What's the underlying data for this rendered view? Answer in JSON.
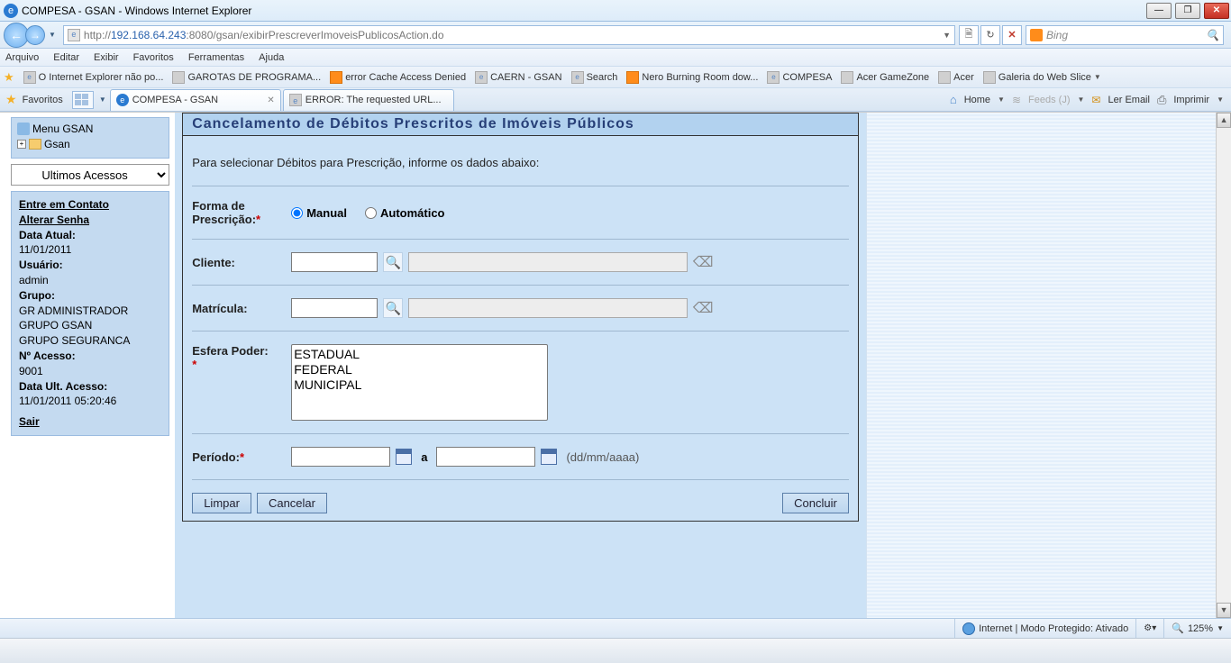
{
  "window": {
    "title": "COMPESA - GSAN - Windows Internet Explorer"
  },
  "url": {
    "prefix": "http://",
    "host": "192.168.64.243",
    "port": ":8080",
    "path": "/gsan/exibirPrescreverImoveisPublicosAction.do"
  },
  "search_provider": "Bing",
  "menu": [
    "Arquivo",
    "Editar",
    "Exibir",
    "Favoritos",
    "Ferramentas",
    "Ajuda"
  ],
  "bookmarks": [
    "O Internet Explorer não po...",
    "GAROTAS DE PROGRAMA...",
    "error Cache Access Denied",
    "CAERN - GSAN",
    "Search",
    "Nero Burning Room dow...",
    "COMPESA",
    "Acer GameZone",
    "Acer",
    "Galeria do Web Slice"
  ],
  "favBarLabel": "Favoritos",
  "tabs": {
    "active": "COMPESA - GSAN",
    "other": "ERROR: The requested URL..."
  },
  "commandBar": {
    "home": "Home",
    "feeds": "Feeds (J)",
    "read_mail": "Ler Email",
    "print": "Imprimir"
  },
  "sidebar": {
    "menu1": "Menu GSAN",
    "menu2": "Gsan",
    "lastAccess": "Ultimos Acessos",
    "contact": "Entre em Contato",
    "changePw": "Alterar Senha",
    "dateLabel": "Data Atual:",
    "date": "11/01/2011",
    "userLabel": "Usuário:",
    "user": "admin",
    "groupLabel": "Grupo:",
    "group1": "GR ADMINISTRADOR",
    "group2": "GRUPO GSAN",
    "group3": "GRUPO SEGURANCA",
    "accessNoLabel": "Nº Acesso:",
    "accessNo": "9001",
    "lastAccLabel": "Data Ult. Acesso:",
    "lastAcc": "11/01/2011 05:20:46",
    "exit": "Sair"
  },
  "panel": {
    "title": "Cancelamento de Débitos Prescritos de Imóveis Públicos",
    "instruction": "Para selecionar Débitos para Prescrição, informe os dados abaixo:",
    "formaLabel": "Forma de Prescrição:",
    "manual": "Manual",
    "automatico": "Automático",
    "cliente": "Cliente:",
    "matricula": "Matrícula:",
    "esfera": "Esfera Poder:",
    "opt1": "ESTADUAL",
    "opt2": "FEDERAL",
    "opt3": "MUNICIPAL",
    "periodo": "Período:",
    "periodSep": "a",
    "dateHint": "(dd/mm/aaaa)",
    "limpar": "Limpar",
    "cancelar": "Cancelar",
    "concluir": "Concluir"
  },
  "status": {
    "zone": "Internet | Modo Protegido: Ativado",
    "zoom": "125%"
  }
}
